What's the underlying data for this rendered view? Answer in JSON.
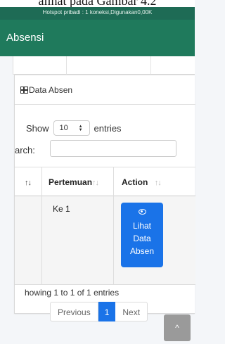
{
  "page": {
    "top_caption": "alihat pada Gambar 4.2"
  },
  "status_bar": {
    "text": "Hotspot pribadi : 1 koneksi,Digunakan0,00K"
  },
  "app_bar": {
    "title": "Absensi"
  },
  "card": {
    "title": "Data Absen",
    "show_label": "Show",
    "entries_value": "10",
    "entries_label": "entries",
    "search_label": "arch:",
    "search_value": ""
  },
  "table": {
    "columns": [
      {
        "label": "",
        "sort_icon": "↑↓"
      },
      {
        "label": "Pertemuan",
        "sort_icon": "↑↓"
      },
      {
        "label": "Action",
        "sort_icon": "↑↓"
      }
    ],
    "rows": [
      {
        "pertemuan": "Ke 1",
        "action_label": "Lihat Data Absen"
      }
    ]
  },
  "info": {
    "text": "howing 1 to 1 of 1 entries"
  },
  "pagination": {
    "previous": "Previous",
    "current": "1",
    "next": "Next"
  },
  "back_to_top": {
    "icon": "chevron-up-icon",
    "glyph": "^"
  }
}
